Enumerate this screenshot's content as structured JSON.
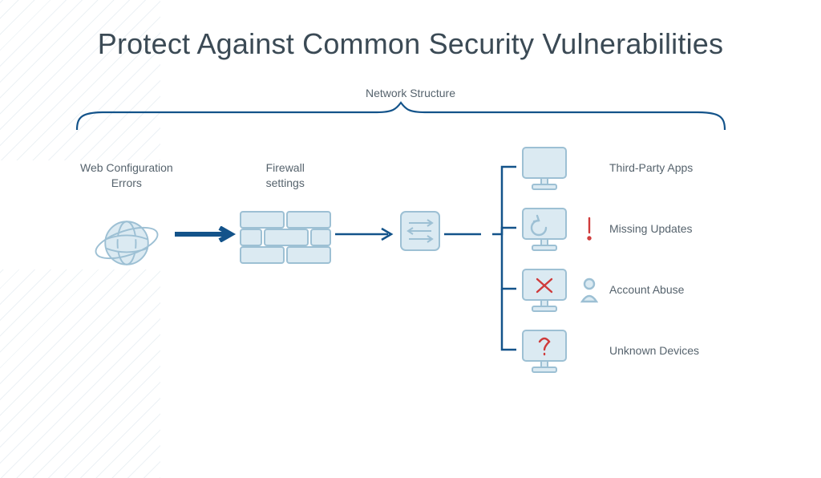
{
  "title": "Protect Against Common Security Vulnerabilities",
  "group_label": "Network Structure",
  "flow": {
    "web": {
      "label": "Web Configuration\nErrors"
    },
    "firewall": {
      "label": "Firewall\nsettings"
    },
    "router": {
      "label": ""
    }
  },
  "devices": [
    {
      "label": "Third-Party Apps",
      "screen_glyph": "none",
      "side_icon": "none"
    },
    {
      "label": "Missing Updates",
      "screen_glyph": "refresh",
      "side_icon": "alert"
    },
    {
      "label": "Account Abuse",
      "screen_glyph": "cross",
      "side_icon": "person"
    },
    {
      "label": "Unknown Devices",
      "screen_glyph": "question",
      "side_icon": "none"
    }
  ]
}
